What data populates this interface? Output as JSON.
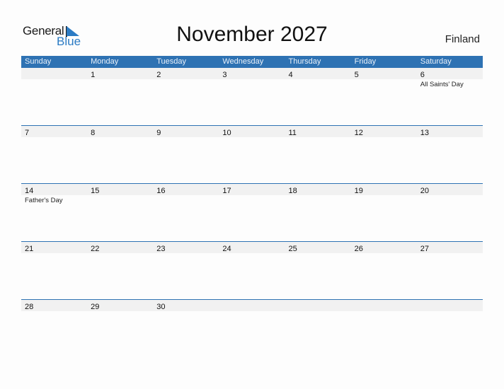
{
  "logo": {
    "line1": "General",
    "line2": "Blue",
    "accent": "#2b7bc4"
  },
  "title": "November 2027",
  "country": "Finland",
  "colors": {
    "header_bg": "#2e72b3",
    "strip_bg": "#f1f1f1"
  },
  "weekdays": [
    "Sunday",
    "Monday",
    "Tuesday",
    "Wednesday",
    "Thursday",
    "Friday",
    "Saturday"
  ],
  "weeks": [
    [
      {
        "d": ""
      },
      {
        "d": "1"
      },
      {
        "d": "2"
      },
      {
        "d": "3"
      },
      {
        "d": "4"
      },
      {
        "d": "5"
      },
      {
        "d": "6",
        "event": "All Saints' Day"
      }
    ],
    [
      {
        "d": "7"
      },
      {
        "d": "8"
      },
      {
        "d": "9"
      },
      {
        "d": "10"
      },
      {
        "d": "11"
      },
      {
        "d": "12"
      },
      {
        "d": "13"
      }
    ],
    [
      {
        "d": "14",
        "event": "Father's Day"
      },
      {
        "d": "15"
      },
      {
        "d": "16"
      },
      {
        "d": "17"
      },
      {
        "d": "18"
      },
      {
        "d": "19"
      },
      {
        "d": "20"
      }
    ],
    [
      {
        "d": "21"
      },
      {
        "d": "22"
      },
      {
        "d": "23"
      },
      {
        "d": "24"
      },
      {
        "d": "25"
      },
      {
        "d": "26"
      },
      {
        "d": "27"
      }
    ],
    [
      {
        "d": "28"
      },
      {
        "d": "29"
      },
      {
        "d": "30"
      },
      {
        "d": ""
      },
      {
        "d": ""
      },
      {
        "d": ""
      },
      {
        "d": ""
      }
    ]
  ]
}
